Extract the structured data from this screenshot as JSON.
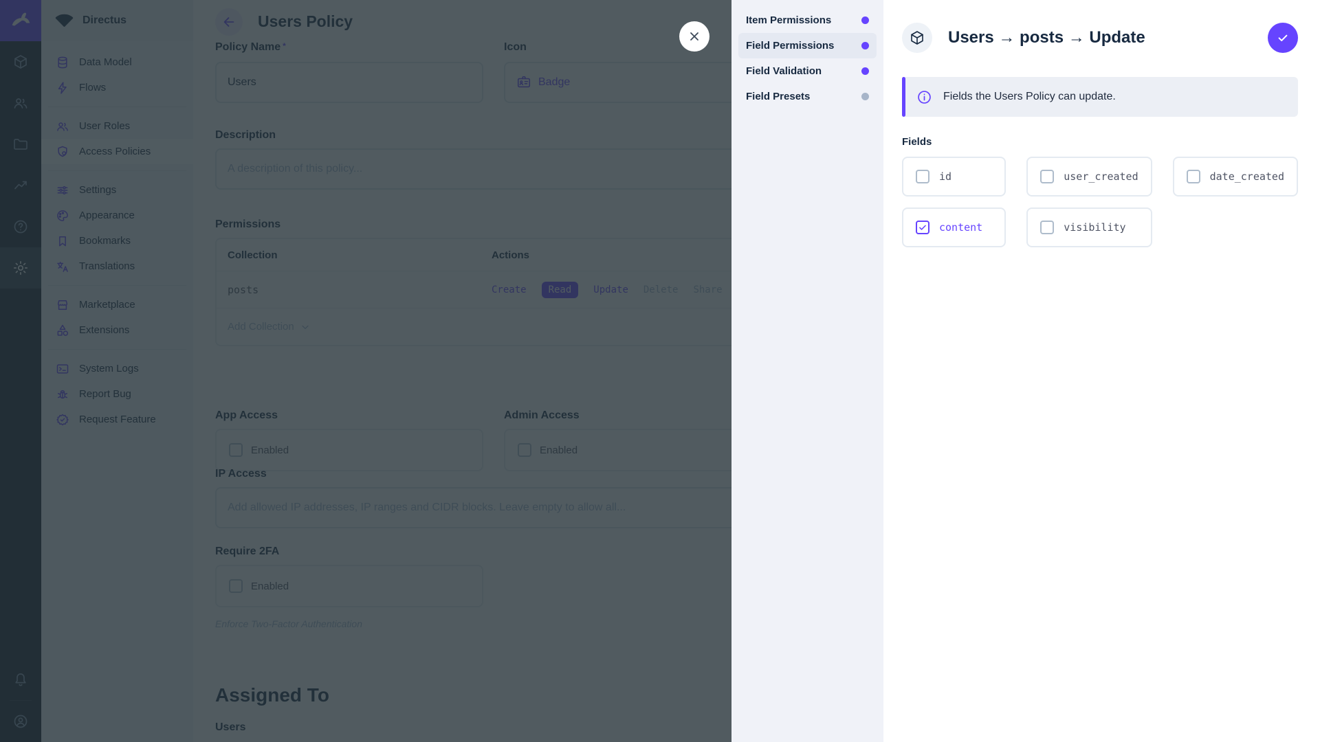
{
  "colors": {
    "accent": "#6644ff",
    "module_bar": "#18222f",
    "nav_bg": "#f0f4f9",
    "overlay": "rgba(38,50,56,0.8)"
  },
  "app": {
    "project_name": "Directus"
  },
  "module_bar": {
    "modules": [
      "content",
      "user-directory",
      "file-library",
      "insights",
      "documentation",
      "settings"
    ],
    "active_module": "settings",
    "bottom": [
      "notifications",
      "account"
    ]
  },
  "nav": {
    "items": [
      {
        "label": "Data Model",
        "icon": "database"
      },
      {
        "label": "Flows",
        "icon": "bolt"
      },
      {
        "label": "User Roles",
        "icon": "people"
      },
      {
        "label": "Access Policies",
        "icon": "shield-lock",
        "active": true
      },
      {
        "label": "Settings",
        "icon": "tune"
      },
      {
        "label": "Appearance",
        "icon": "palette"
      },
      {
        "label": "Bookmarks",
        "icon": "bookmark"
      },
      {
        "label": "Translations",
        "icon": "translate"
      },
      {
        "label": "Marketplace",
        "icon": "storefront"
      },
      {
        "label": "Extensions",
        "icon": "category"
      },
      {
        "label": "System Logs",
        "icon": "terminal"
      },
      {
        "label": "Report Bug",
        "icon": "bug"
      },
      {
        "label": "Request Feature",
        "icon": "new-releases"
      }
    ]
  },
  "page": {
    "title": "Users Policy",
    "policy_name": {
      "label": "Policy Name",
      "required": "*",
      "value": "Users"
    },
    "icon": {
      "label": "Icon",
      "value": "Badge"
    },
    "description": {
      "label": "Description",
      "placeholder": "A description of this policy..."
    },
    "permissions": {
      "label": "Permissions",
      "col_collection": "Collection",
      "col_actions": "Actions",
      "rows": [
        {
          "collection": "posts",
          "actions": [
            {
              "label": "Create",
              "state": "allowed"
            },
            {
              "label": "Read",
              "state": "selected"
            },
            {
              "label": "Update",
              "state": "allowed"
            },
            {
              "label": "Delete",
              "state": "denied"
            },
            {
              "label": "Share",
              "state": "denied"
            }
          ]
        }
      ],
      "add_label": "Add Collection"
    },
    "app_access": {
      "label": "App Access",
      "checkbox_label": "Enabled",
      "checked": false
    },
    "admin_access": {
      "label": "Admin Access",
      "checkbox_label": "Enabled",
      "checked": false
    },
    "ip_access": {
      "label": "IP Access",
      "placeholder": "Add allowed IP addresses, IP ranges and CIDR blocks. Leave empty to allow all..."
    },
    "require_2fa": {
      "label": "Require 2FA",
      "checkbox_label": "Enabled",
      "checked": false,
      "note": "Enforce Two-Factor Authentication"
    },
    "assigned_to": {
      "heading": "Assigned To",
      "users_label": "Users"
    }
  },
  "drawer": {
    "nav": [
      {
        "label": "Item Permissions",
        "dot": "purple"
      },
      {
        "label": "Field Permissions",
        "dot": "purple",
        "active": true
      },
      {
        "label": "Field Validation",
        "dot": "purple"
      },
      {
        "label": "Field Presets",
        "dot": "gray"
      }
    ],
    "header": {
      "title": "Users → posts → Update",
      "icon": "cube",
      "save_icon": "check"
    },
    "banner": {
      "icon": "info",
      "text": "Fields the Users Policy can update."
    },
    "fields": {
      "label": "Fields",
      "options": [
        {
          "name": "id",
          "checked": false
        },
        {
          "name": "user_created",
          "checked": false
        },
        {
          "name": "date_created",
          "checked": false
        },
        {
          "name": "content",
          "checked": true
        },
        {
          "name": "visibility",
          "checked": false
        }
      ]
    }
  }
}
